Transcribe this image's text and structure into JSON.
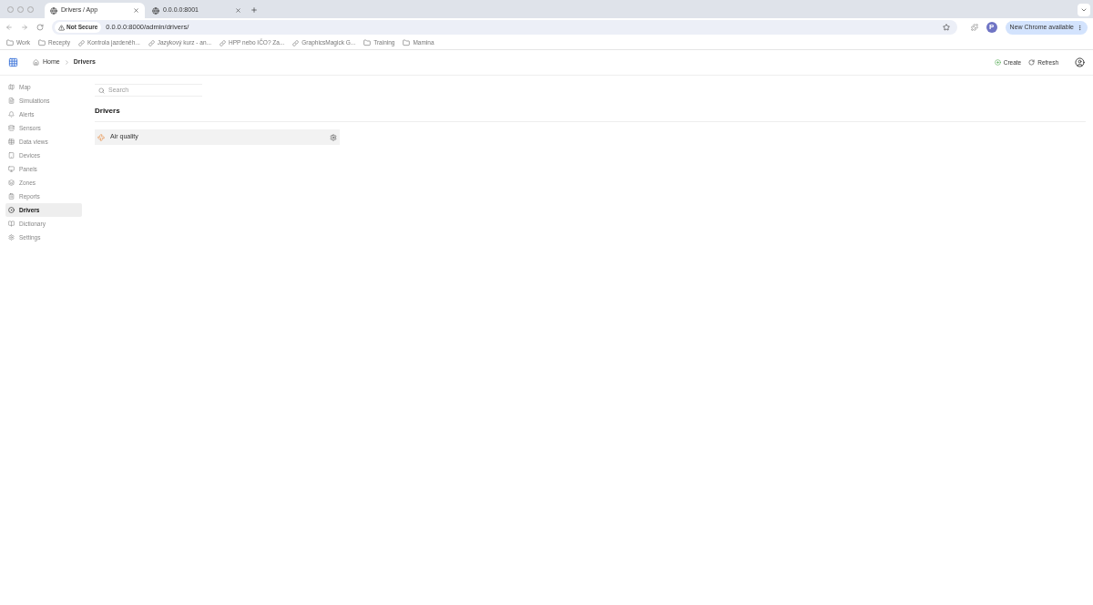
{
  "browser": {
    "tabs": [
      {
        "title": "Drivers / App",
        "selected": true
      },
      {
        "title": "0.0.0.0:8001",
        "selected": false
      }
    ],
    "security": "Not Secure",
    "url": "0.0.0.0:8000/admin/drivers/",
    "update_button": "New Chrome available",
    "profile_initial": "P",
    "bookmarks": [
      {
        "kind": "folder",
        "label": "Work"
      },
      {
        "kind": "folder",
        "label": "Recepty"
      },
      {
        "kind": "site",
        "label": "Kontrola jazdeněh..."
      },
      {
        "kind": "site",
        "label": "Jazykový kurz - an..."
      },
      {
        "kind": "site",
        "label": "HPP nebo IČO? Za..."
      },
      {
        "kind": "site",
        "label": "GraphicsMagick G..."
      },
      {
        "kind": "folder",
        "label": "Training"
      },
      {
        "kind": "folder",
        "label": "Mamina"
      }
    ]
  },
  "header": {
    "breadcrumb": [
      "Home",
      "Drivers"
    ],
    "actions": [
      "Create",
      "Refresh"
    ]
  },
  "sidebar": {
    "items": [
      {
        "label": "Map",
        "selected": false
      },
      {
        "label": "Simulations",
        "selected": false
      },
      {
        "label": "Alerts",
        "selected": false
      },
      {
        "label": "Sensors",
        "selected": false
      },
      {
        "label": "Data views",
        "selected": false
      },
      {
        "label": "Devices",
        "selected": false
      },
      {
        "label": "Panels",
        "selected": false
      },
      {
        "label": "Zones",
        "selected": false
      },
      {
        "label": "Reports",
        "selected": false
      },
      {
        "label": "Drivers",
        "selected": true
      },
      {
        "label": "Dictionary",
        "selected": false
      },
      {
        "label": "Settings",
        "selected": false
      }
    ]
  },
  "search": {
    "placeholder": "Search"
  },
  "section_title": "Drivers",
  "drivers": [
    {
      "name": "Air quality"
    }
  ]
}
